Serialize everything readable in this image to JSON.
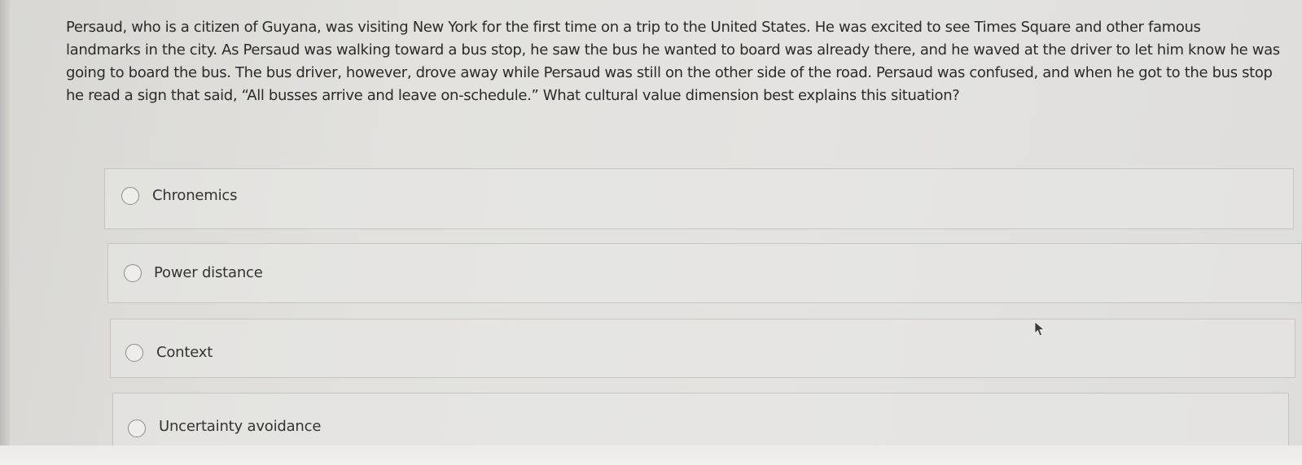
{
  "question": {
    "lines": [
      "Persaud, who is a citizen of Guyana, was visiting New York for the first time on a trip to the United States. He was excited to see Times Square and other famous",
      "landmarks in the city. As Persaud was walking toward a bus stop, he saw the bus he wanted to board was already there, and he waved at the driver to let him know he was",
      "going to board the bus. The bus driver, however, drove away while Persaud was still on the other side of the road. Persaud was confused, and when he got to the bus stop",
      "he read a sign that said, “All busses arrive and leave on-schedule.” What cultural value dimension best explains this situation?"
    ]
  },
  "options": [
    {
      "label": "Chronemics"
    },
    {
      "label": "Power distance"
    },
    {
      "label": "Context"
    },
    {
      "label": "Uncertainty avoidance"
    }
  ],
  "colors": {
    "text": "#2b2b2b",
    "border": "#c6c5c2",
    "background": "#e2e1de"
  },
  "icons": {
    "cursor": "mouse-pointer-icon"
  }
}
